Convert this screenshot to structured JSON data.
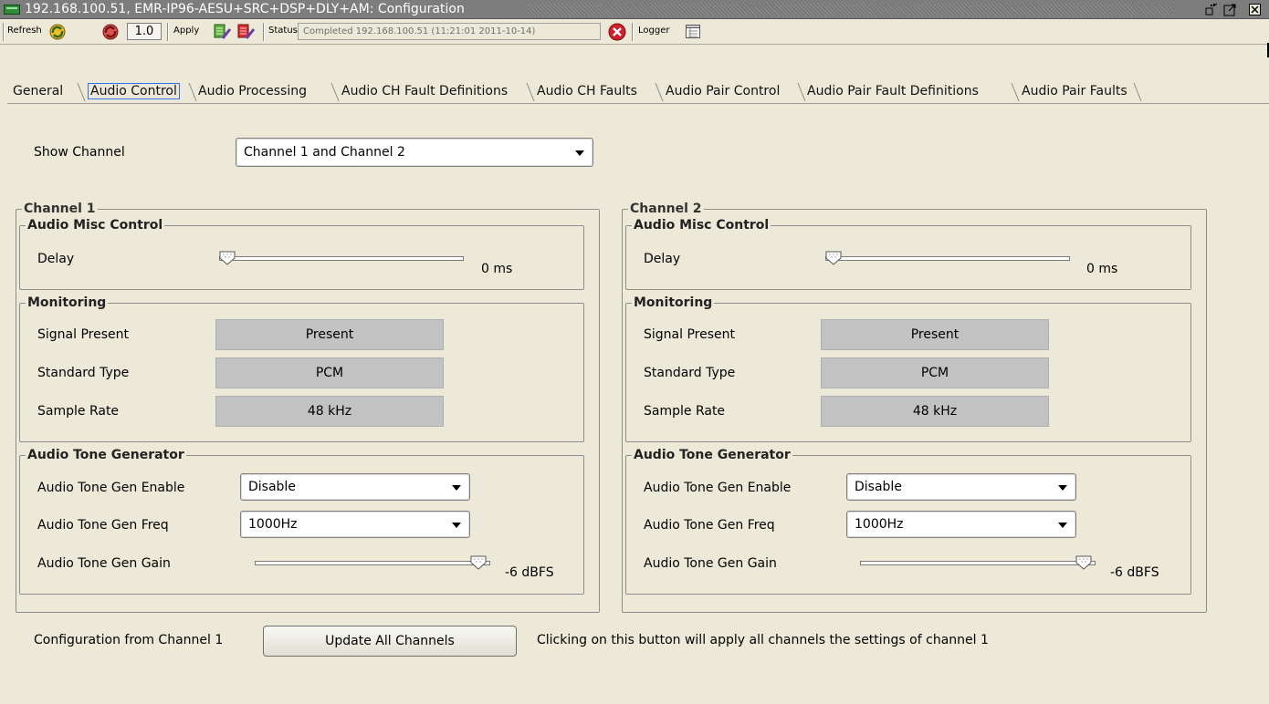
{
  "window": {
    "title": "192.168.100.51, EMR-IP96-AESU+SRC+DSP+DLY+AM: Configuration"
  },
  "toolbar": {
    "refresh_label": "Refresh",
    "interval_value": "1.0",
    "apply_label": "Apply",
    "status_label": "Status",
    "status_text": "Completed 192.168.100.51 (11:21:01  2011-10-14)",
    "logger_label": "Logger"
  },
  "tabs": [
    {
      "label": "General"
    },
    {
      "label": "Audio Control",
      "active": true
    },
    {
      "label": "Audio Processing"
    },
    {
      "label": "Audio CH Fault Definitions"
    },
    {
      "label": "Audio CH Faults"
    },
    {
      "label": "Audio Pair Control"
    },
    {
      "label": "Audio Pair Fault Definitions"
    },
    {
      "label": "Audio Pair Faults"
    }
  ],
  "show_channel": {
    "label": "Show Channel",
    "value": "Channel 1 and Channel 2"
  },
  "channels": [
    {
      "title": "Channel 1",
      "misc": {
        "title": "Audio Misc Control",
        "delay_label": "Delay",
        "delay_value": "0 ms",
        "delay_fraction": 0.0
      },
      "monitoring": {
        "title": "Monitoring",
        "signal_present_label": "Signal Present",
        "signal_present_value": "Present",
        "standard_type_label": "Standard Type",
        "standard_type_value": "PCM",
        "sample_rate_label": "Sample Rate",
        "sample_rate_value": "48 kHz"
      },
      "tone": {
        "title": "Audio Tone Generator",
        "enable_label": "Audio Tone Gen Enable",
        "enable_value": "Disable",
        "freq_label": "Audio Tone Gen Freq",
        "freq_value": "1000Hz",
        "gain_label": "Audio Tone Gen Gain",
        "gain_value": "-6 dBFS",
        "gain_fraction": 1.0
      }
    },
    {
      "title": "Channel 2",
      "misc": {
        "title": "Audio Misc Control",
        "delay_label": "Delay",
        "delay_value": "0 ms",
        "delay_fraction": 0.0
      },
      "monitoring": {
        "title": "Monitoring",
        "signal_present_label": "Signal Present",
        "signal_present_value": "Present",
        "standard_type_label": "Standard Type",
        "standard_type_value": "PCM",
        "sample_rate_label": "Sample Rate",
        "sample_rate_value": "48 kHz"
      },
      "tone": {
        "title": "Audio Tone Generator",
        "enable_label": "Audio Tone Gen Enable",
        "enable_value": "Disable",
        "freq_label": "Audio Tone Gen Freq",
        "freq_value": "1000Hz",
        "gain_label": "Audio Tone Gen Gain",
        "gain_value": "-6 dBFS",
        "gain_fraction": 1.0
      }
    }
  ],
  "config": {
    "label": "Configuration from Channel 1",
    "button_label": "Update All Channels",
    "note": "Clicking on this button will apply all channels the settings of channel 1"
  },
  "colors": {
    "background": "#ece9d8",
    "titlebar": "#7d7d7d",
    "readout": "#c2c2c2",
    "active_tab_focus": "#3a6ee8",
    "error_icon": "#d2202a"
  }
}
